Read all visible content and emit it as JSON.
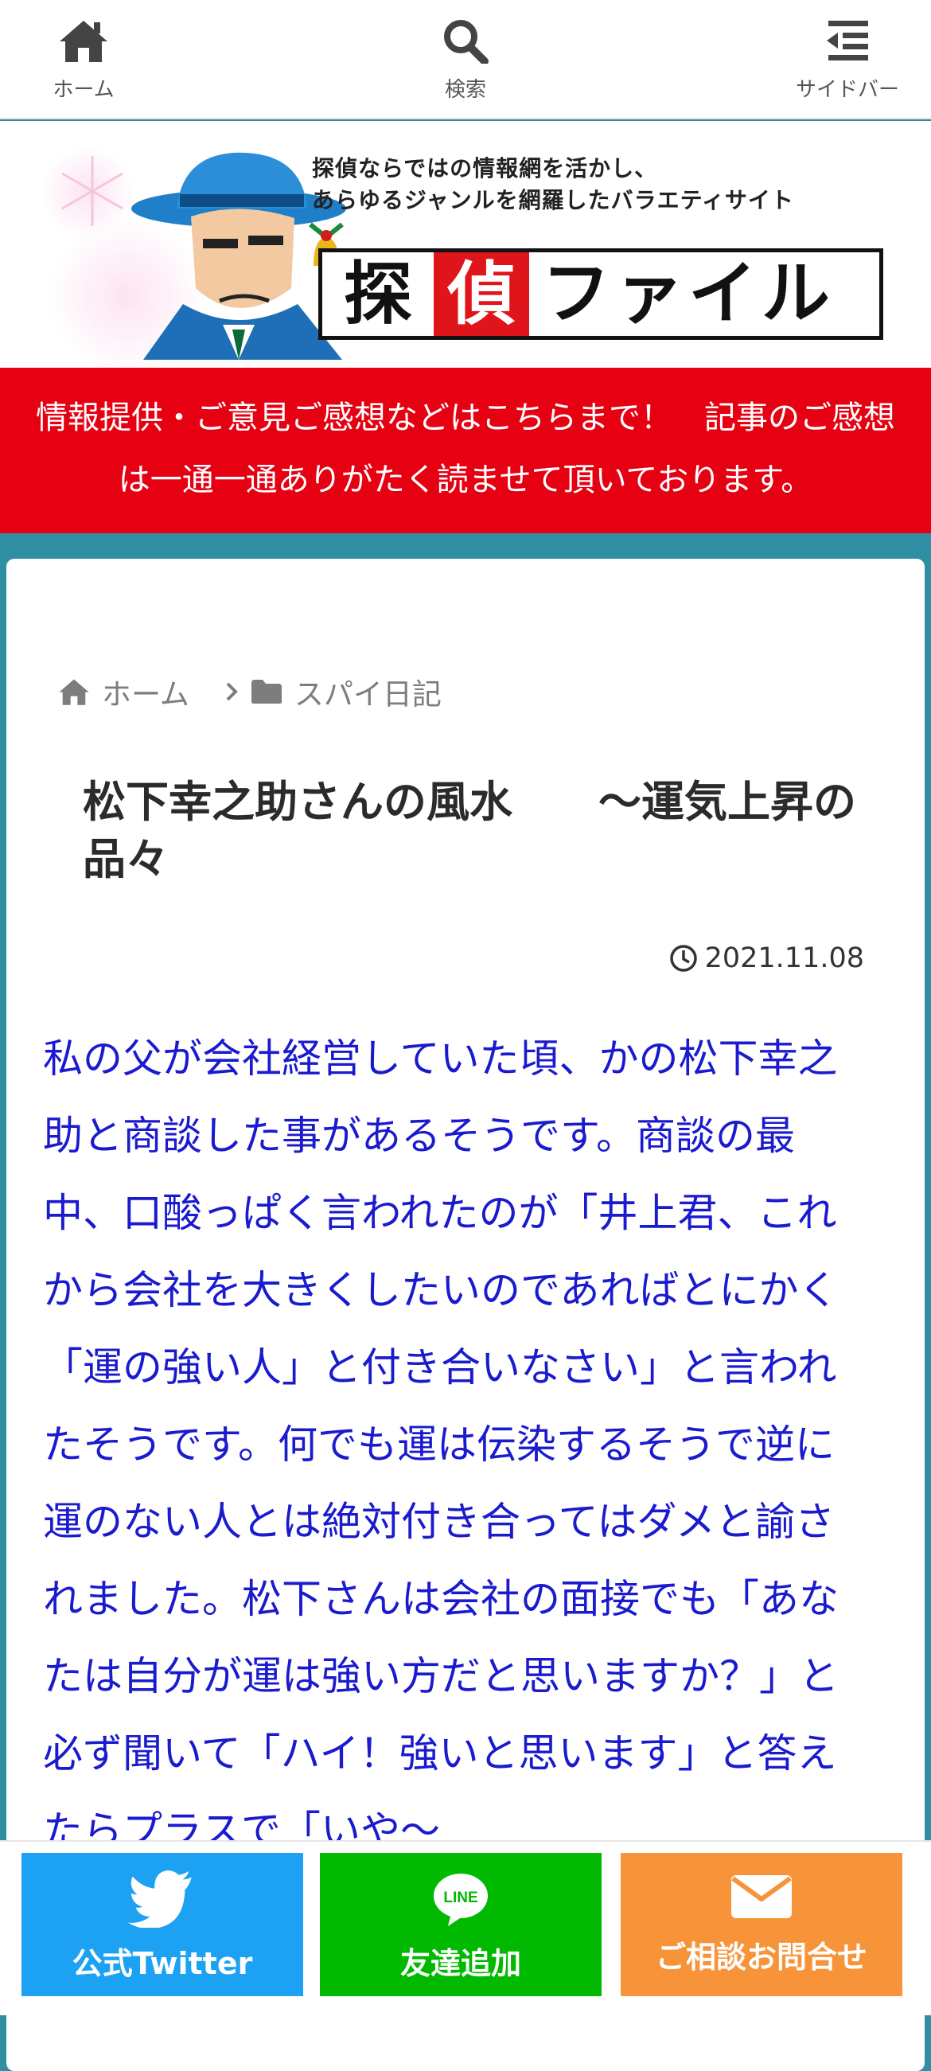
{
  "nav": {
    "home_label": "ホーム",
    "search_label": "検索",
    "sidebar_label": "サイドバー"
  },
  "header": {
    "tagline_line1": "探偵ならではの情報網を活かし、",
    "tagline_line2": "あらゆるジャンルを網羅したバラエティサイト",
    "logo_char1": "探",
    "logo_char2": "偵",
    "logo_rest": "ファイル"
  },
  "notice": {
    "text": "情報提供・ご意見ご感想などはこちらまで！　記事のご感想は一通一通ありがたく読ませて頂いております。"
  },
  "breadcrumb": {
    "home": "ホーム",
    "category": "スパイ日記"
  },
  "article": {
    "title": "松下幸之助さんの風水　　～運気上昇の品々",
    "date": "2021.11.08",
    "body": "私の父が会社経営していた頃、かの松下幸之助と商談した事があるそうです。商談の最中、口酸っぱく言われたのが「井上君、これから会社を大きくしたいのであればとにかく「運の強い人」と付き合いなさい」と言われたそうです。何でも運は伝染するそうで逆に運のない人とは絶対付き合ってはダメと諭されました。松下さんは会社の面接でも「あなたは自分が運は強い方だと思いますか？」と必ず聞いて「ハイ！強いと思います」と答えたらプラスで「いや～"
  },
  "cta": {
    "twitter_label": "公式Twitter",
    "line_label": "友達追加",
    "line_icon_text": "LINE",
    "contact_label": "ご相談お問合せ"
  },
  "colors": {
    "accent_red": "#e60012",
    "body_blue": "#1a1acf",
    "page_teal": "#2e8fa3",
    "twitter_blue": "#1da1f2",
    "line_green": "#00b900",
    "contact_orange": "#f7943a"
  }
}
